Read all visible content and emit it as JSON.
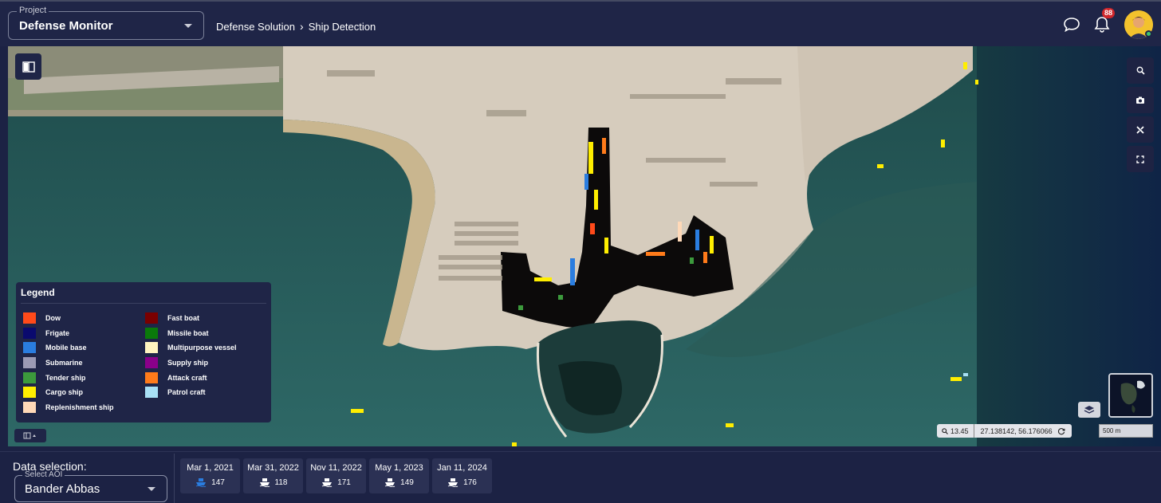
{
  "header": {
    "project_label": "Project",
    "project_value": "Defense Monitor",
    "breadcrumb": [
      "Defense Solution",
      "Ship Detection"
    ],
    "notification_count": "88"
  },
  "legend": {
    "title": "Legend",
    "col1": [
      {
        "label": "Dow",
        "color": "#ff4a1a"
      },
      {
        "label": "Frigate",
        "color": "#0a0a6e"
      },
      {
        "label": "Mobile base",
        "color": "#2a7de0"
      },
      {
        "label": "Submarine",
        "color": "#9b9ab4"
      },
      {
        "label": "Tender ship",
        "color": "#3c9a3c"
      },
      {
        "label": "Cargo ship",
        "color": "#ffee00"
      },
      {
        "label": "Replenishment ship",
        "color": "#ffd9b8"
      }
    ],
    "col2": [
      {
        "label": "Fast boat",
        "color": "#7a0000"
      },
      {
        "label": "Missile boat",
        "color": "#0a7a0a"
      },
      {
        "label": "Multipurpose vessel",
        "color": "#fff5c0"
      },
      {
        "label": "Supply ship",
        "color": "#8a008a"
      },
      {
        "label": "Attack craft",
        "color": "#ff7b1a"
      },
      {
        "label": "Patrol craft",
        "color": "#a8e0f5"
      }
    ]
  },
  "map": {
    "zoom": "13.45",
    "coordinates": "27.138142,  56.176066",
    "scale": "500 m"
  },
  "data_selection": {
    "label": "Data selection:",
    "aoi_label": "Select AOI",
    "aoi_value": "Bander Abbas",
    "dates": [
      {
        "date": "Mar 1, 2021",
        "count": "147"
      },
      {
        "date": "Mar 31, 2022",
        "count": "118"
      },
      {
        "date": "Nov 11, 2022",
        "count": "171"
      },
      {
        "date": "May 1, 2023",
        "count": "149"
      },
      {
        "date": "Jan 11, 2024",
        "count": "176"
      }
    ]
  }
}
